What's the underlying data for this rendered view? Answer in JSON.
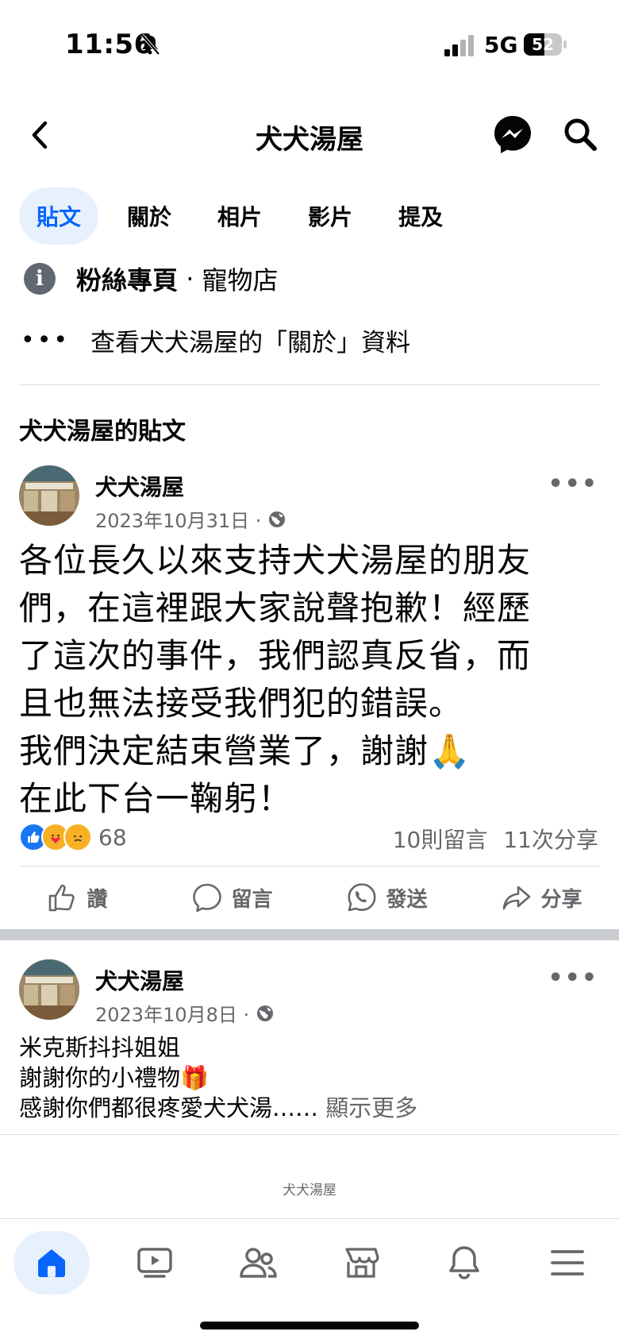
{
  "status_bar": {
    "time": "11:56",
    "network": "5G",
    "battery": "52"
  },
  "header": {
    "title": "犬犬湯屋"
  },
  "tabs": [
    {
      "label": "貼文",
      "active": true
    },
    {
      "label": "關於",
      "active": false
    },
    {
      "label": "相片",
      "active": false
    },
    {
      "label": "影片",
      "active": false
    },
    {
      "label": "提及",
      "active": false
    }
  ],
  "info": {
    "type_bold": "粉絲專頁",
    "separator": " · ",
    "category": "寵物店"
  },
  "about_link": "查看犬犬湯屋的「關於」資料",
  "section_title": "犬犬湯屋的貼文",
  "posts": [
    {
      "author": "犬犬湯屋",
      "date": "2023年10月31日 ·",
      "text_lines": [
        "各位長久以來支持犬犬湯屋的朋友",
        "們，在這裡跟大家說聲抱歉！經歷",
        "了這次的事件，我們認真反省，而",
        "且也無法接受我們犯的錯誤。",
        "我們決定結束營業了，謝謝🙏",
        "在此下台一鞠躬！"
      ],
      "reactions_count": "68",
      "comments": "10則留言",
      "shares": "11次分享"
    },
    {
      "author": "犬犬湯屋",
      "date": "2023年10月8日 ·",
      "text_lines": [
        "米克斯抖抖姐姐",
        "謝謝你的小禮物🎁",
        "感謝你們都很疼愛犬犬湯……"
      ],
      "show_more": "顯示更多"
    }
  ],
  "actions": {
    "like": "讚",
    "comment": "留言",
    "send": "發送",
    "share": "分享"
  },
  "footer_brand": "犬犬湯屋",
  "colors": {
    "accent": "#0866ff",
    "secondary_text": "#65676b",
    "tab_active_bg": "#e7f0fd"
  }
}
